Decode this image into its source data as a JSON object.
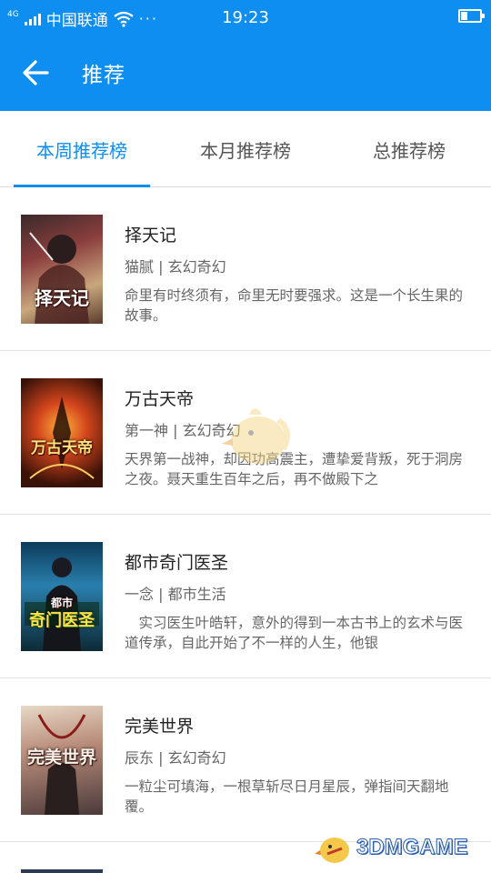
{
  "status_bar": {
    "network_type": "4G",
    "carrier": "中国联通",
    "more": "···",
    "time": "19:23",
    "battery_level": 0.35
  },
  "header": {
    "title": "推荐",
    "back_icon": "arrow-left-icon"
  },
  "tabs": [
    {
      "label": "本周推荐榜",
      "active": true
    },
    {
      "label": "本月推荐榜",
      "active": false
    },
    {
      "label": "总推荐榜",
      "active": false
    }
  ],
  "books": [
    {
      "title": "择天记",
      "author": "猫腻",
      "genre": "玄幻奇幻",
      "description": "命里有时终须有，命里无时要强求。这是一个长生果的故事。",
      "cover_text": "择天记"
    },
    {
      "title": "万古天帝",
      "author": "第一神",
      "genre": "玄幻奇幻",
      "description": "天界第一战神，却因功高震主，遭挚爱背叛，死于洞房之夜。聂天重生百年之后，再不做殿下之",
      "cover_text": "万古天帝"
    },
    {
      "title": "都市奇门医圣",
      "author": "一念",
      "genre": "都市生活",
      "description": "　实习医生叶皓轩，意外的得到一本古书上的玄术与医道传承，自此开始了不一样的人生，他银",
      "cover_text": "奇门医圣",
      "cover_subtext": "都市"
    },
    {
      "title": "完美世界",
      "author": "辰东",
      "genre": "玄幻奇幻",
      "description": "一粒尘可填海，一根草斩尽日月星辰，弹指间天翻地覆。",
      "cover_text": "完美世界"
    }
  ],
  "watermark": {
    "logo_text": "3DMGAME"
  },
  "colors": {
    "accent": "#0e8ef0",
    "text_primary": "#222222",
    "text_secondary": "#666666",
    "divider": "#e2e2e2"
  }
}
